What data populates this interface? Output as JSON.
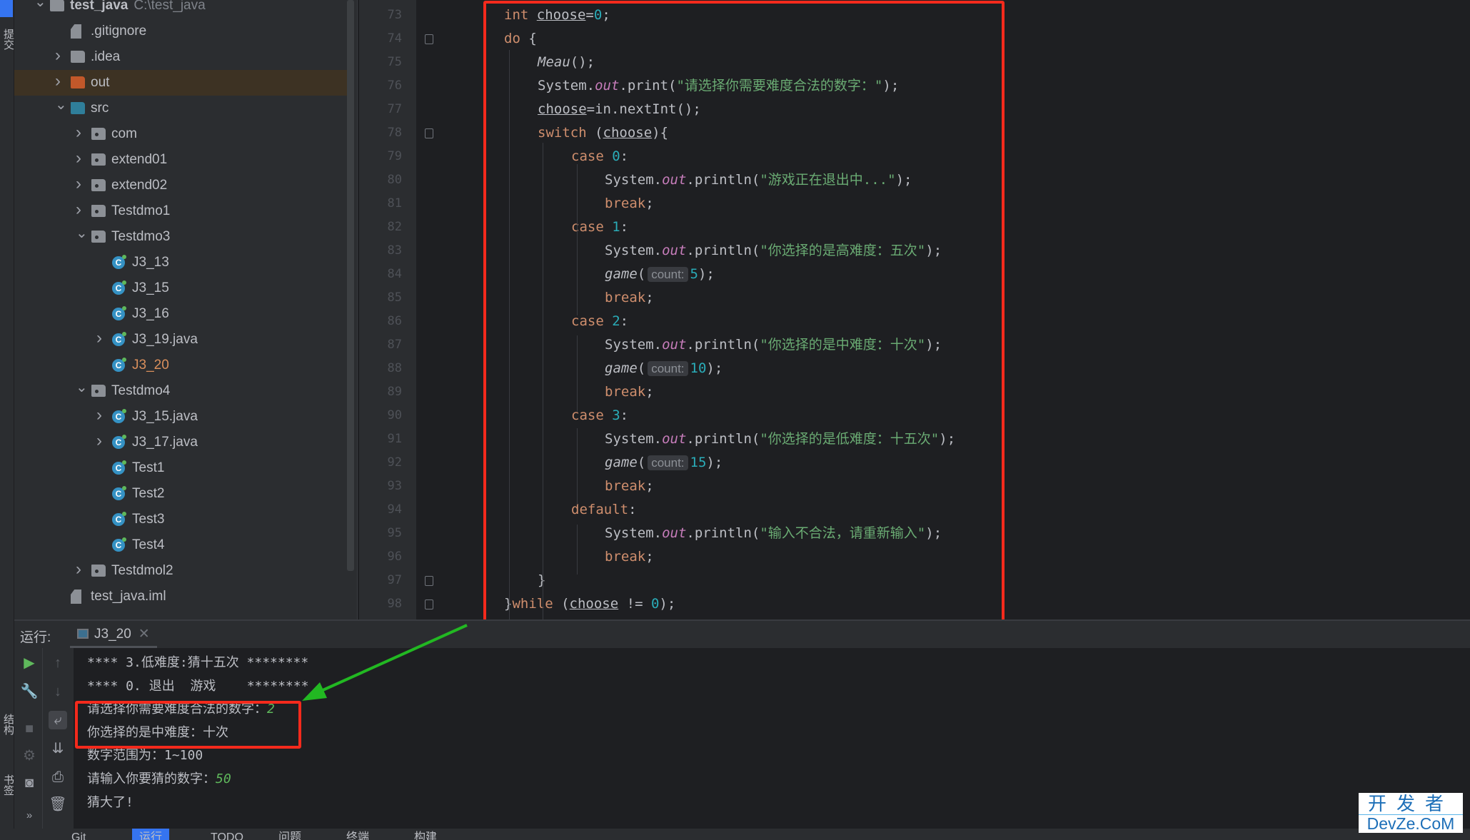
{
  "left_strip": {
    "labels": [
      "提交",
      "结构",
      "书签"
    ]
  },
  "project_tree": {
    "items": [
      {
        "level": 0,
        "chevron": "down",
        "icon": "project-icon",
        "label": "test_java",
        "path": "C:\\test_java"
      },
      {
        "level": 1,
        "chevron": "none",
        "icon": "ignore-file-icon",
        "label": ".gitignore"
      },
      {
        "level": 1,
        "chevron": "right",
        "icon": "folder-gray",
        "label": ".idea"
      },
      {
        "level": 1,
        "chevron": "right",
        "icon": "folder-orange",
        "label": "out",
        "highlighted": true
      },
      {
        "level": 1,
        "chevron": "down",
        "icon": "folder-blue",
        "label": "src"
      },
      {
        "level": 2,
        "chevron": "right",
        "icon": "package-icon",
        "label": "com"
      },
      {
        "level": 2,
        "chevron": "right",
        "icon": "package-icon",
        "label": "extend01"
      },
      {
        "level": 2,
        "chevron": "right",
        "icon": "package-icon",
        "label": "extend02"
      },
      {
        "level": 2,
        "chevron": "right",
        "icon": "package-icon",
        "label": "Testdmo1"
      },
      {
        "level": 2,
        "chevron": "down",
        "icon": "package-icon",
        "label": "Testdmo3"
      },
      {
        "level": 3,
        "chevron": "none",
        "icon": "class-icon",
        "label": "J3_13"
      },
      {
        "level": 3,
        "chevron": "none",
        "icon": "class-icon",
        "label": "J3_15"
      },
      {
        "level": 3,
        "chevron": "none",
        "icon": "class-icon",
        "label": "J3_16"
      },
      {
        "level": 3,
        "chevron": "right",
        "icon": "class-icon",
        "label": "J3_19.java"
      },
      {
        "level": 3,
        "chevron": "none",
        "icon": "class-icon",
        "label": "J3_20",
        "modified": true
      },
      {
        "level": 2,
        "chevron": "down",
        "icon": "package-icon",
        "label": "Testdmo4"
      },
      {
        "level": 3,
        "chevron": "right",
        "icon": "class-icon",
        "label": "J3_15.java"
      },
      {
        "level": 3,
        "chevron": "right",
        "icon": "class-icon",
        "label": "J3_17.java"
      },
      {
        "level": 3,
        "chevron": "none",
        "icon": "class-icon",
        "label": "Test1"
      },
      {
        "level": 3,
        "chevron": "none",
        "icon": "class-icon",
        "label": "Test2"
      },
      {
        "level": 3,
        "chevron": "none",
        "icon": "class-icon",
        "label": "Test3"
      },
      {
        "level": 3,
        "chevron": "none",
        "icon": "class-icon",
        "label": "Test4"
      },
      {
        "level": 2,
        "chevron": "right",
        "icon": "package-icon",
        "label": "Testdmol2"
      },
      {
        "level": 1,
        "chevron": "none",
        "icon": "module-file-icon",
        "label": "test_java.iml"
      }
    ]
  },
  "editor": {
    "lines": [
      {
        "num": "73",
        "indent": 1,
        "tokens": [
          [
            "int",
            "k"
          ],
          [
            " ",
            "p"
          ],
          [
            "choose",
            "u"
          ],
          [
            "=",
            "p"
          ],
          [
            "0",
            "n"
          ],
          [
            ";",
            "p"
          ]
        ]
      },
      {
        "num": "74",
        "indent": 1,
        "fold": true,
        "tokens": [
          [
            "do",
            "k"
          ],
          [
            " {",
            "p"
          ]
        ]
      },
      {
        "num": "75",
        "indent": 2,
        "tokens": [
          [
            "Meau",
            "m"
          ],
          [
            "();",
            "p"
          ]
        ]
      },
      {
        "num": "76",
        "indent": 2,
        "tokens": [
          [
            "System.",
            "p"
          ],
          [
            "out",
            "o"
          ],
          [
            ".print(",
            "p"
          ],
          [
            "\"请选择你需要难度合法的数字：\"",
            "s"
          ],
          [
            ");",
            "p"
          ]
        ]
      },
      {
        "num": "77",
        "indent": 2,
        "tokens": [
          [
            "choose",
            "u"
          ],
          [
            "=in.nextInt();",
            "p"
          ]
        ]
      },
      {
        "num": "78",
        "indent": 2,
        "fold": true,
        "tokens": [
          [
            "switch",
            "k"
          ],
          [
            " (",
            "p"
          ],
          [
            "choose",
            "u"
          ],
          [
            "){",
            "p"
          ]
        ]
      },
      {
        "num": "79",
        "indent": 3,
        "tokens": [
          [
            "case",
            "k"
          ],
          [
            " ",
            "p"
          ],
          [
            "0",
            "n"
          ],
          [
            ":",
            "p"
          ]
        ]
      },
      {
        "num": "80",
        "indent": 4,
        "tokens": [
          [
            "System.",
            "p"
          ],
          [
            "out",
            "o"
          ],
          [
            ".println(",
            "p"
          ],
          [
            "\"游戏正在退出中...\"",
            "s"
          ],
          [
            ");",
            "p"
          ]
        ]
      },
      {
        "num": "81",
        "indent": 4,
        "tokens": [
          [
            "break",
            "k"
          ],
          [
            ";",
            "p"
          ]
        ]
      },
      {
        "num": "82",
        "indent": 3,
        "tokens": [
          [
            "case",
            "k"
          ],
          [
            " ",
            "p"
          ],
          [
            "1",
            "n"
          ],
          [
            ":",
            "p"
          ]
        ]
      },
      {
        "num": "83",
        "indent": 4,
        "tokens": [
          [
            "System.",
            "p"
          ],
          [
            "out",
            "o"
          ],
          [
            ".println(",
            "p"
          ],
          [
            "\"你选择的是高难度：五次\"",
            "s"
          ],
          [
            ");",
            "p"
          ]
        ]
      },
      {
        "num": "84",
        "indent": 4,
        "tokens": [
          [
            "game",
            "m"
          ],
          [
            "(",
            "p"
          ],
          [
            "count:",
            "h"
          ],
          [
            "5",
            "n"
          ],
          [
            ");",
            "p"
          ]
        ]
      },
      {
        "num": "85",
        "indent": 4,
        "tokens": [
          [
            "break",
            "k"
          ],
          [
            ";",
            "p"
          ]
        ]
      },
      {
        "num": "86",
        "indent": 3,
        "tokens": [
          [
            "case",
            "k"
          ],
          [
            " ",
            "p"
          ],
          [
            "2",
            "n"
          ],
          [
            ":",
            "p"
          ]
        ]
      },
      {
        "num": "87",
        "indent": 4,
        "tokens": [
          [
            "System.",
            "p"
          ],
          [
            "out",
            "o"
          ],
          [
            ".println(",
            "p"
          ],
          [
            "\"你选择的是中难度：十次\"",
            "s"
          ],
          [
            ");",
            "p"
          ]
        ]
      },
      {
        "num": "88",
        "indent": 4,
        "tokens": [
          [
            "game",
            "m"
          ],
          [
            "(",
            "p"
          ],
          [
            "count:",
            "h"
          ],
          [
            "10",
            "n"
          ],
          [
            ");",
            "p"
          ]
        ]
      },
      {
        "num": "89",
        "indent": 4,
        "tokens": [
          [
            "break",
            "k"
          ],
          [
            ";",
            "p"
          ]
        ]
      },
      {
        "num": "90",
        "indent": 3,
        "tokens": [
          [
            "case",
            "k"
          ],
          [
            " ",
            "p"
          ],
          [
            "3",
            "n"
          ],
          [
            ":",
            "p"
          ]
        ]
      },
      {
        "num": "91",
        "indent": 4,
        "tokens": [
          [
            "System.",
            "p"
          ],
          [
            "out",
            "o"
          ],
          [
            ".println(",
            "p"
          ],
          [
            "\"你选择的是低难度：十五次\"",
            "s"
          ],
          [
            ");",
            "p"
          ]
        ]
      },
      {
        "num": "92",
        "indent": 4,
        "tokens": [
          [
            "game",
            "m"
          ],
          [
            "(",
            "p"
          ],
          [
            "count:",
            "h"
          ],
          [
            "15",
            "n"
          ],
          [
            ");",
            "p"
          ]
        ]
      },
      {
        "num": "93",
        "indent": 4,
        "tokens": [
          [
            "break",
            "k"
          ],
          [
            ";",
            "p"
          ]
        ]
      },
      {
        "num": "94",
        "indent": 3,
        "tokens": [
          [
            "default",
            "k"
          ],
          [
            ":",
            "p"
          ]
        ]
      },
      {
        "num": "95",
        "indent": 4,
        "tokens": [
          [
            "System.",
            "p"
          ],
          [
            "out",
            "o"
          ],
          [
            ".println(",
            "p"
          ],
          [
            "\"输入不合法，请重新输入\"",
            "s"
          ],
          [
            ");",
            "p"
          ]
        ]
      },
      {
        "num": "96",
        "indent": 4,
        "tokens": [
          [
            "break",
            "k"
          ],
          [
            ";",
            "p"
          ]
        ]
      },
      {
        "num": "97",
        "indent": 2,
        "fold": true,
        "tokens": [
          [
            "}",
            "p"
          ]
        ]
      },
      {
        "num": "98",
        "indent": 1,
        "fold": true,
        "tokens": [
          [
            "}",
            "p"
          ],
          [
            "while",
            "k"
          ],
          [
            " (",
            "p"
          ],
          [
            "choose",
            "u"
          ],
          [
            " != ",
            "p"
          ],
          [
            "0",
            "n"
          ],
          [
            ");",
            "p"
          ]
        ]
      }
    ]
  },
  "run_panel": {
    "label": "运行:",
    "tab": "J3_20",
    "console": [
      {
        "text": "**** 3.低难度:猜十五次 ********"
      },
      {
        "text": "**** 0. 退出  游戏    ********"
      },
      {
        "text": "请选择你需要难度合法的数字：",
        "input": "2"
      },
      {
        "text": "你选择的是中难度：十次"
      },
      {
        "text": "数字范围为：1~100"
      },
      {
        "text": "请输入你要猜的数字：",
        "input": "50"
      },
      {
        "text": "猜大了!"
      }
    ]
  },
  "bottom_bar": {
    "items": [
      "Git",
      "运行",
      "TODO",
      "问题",
      "终端",
      "构建"
    ],
    "active": "运行"
  },
  "watermark": {
    "line1": "开发者",
    "line2": "DevZe.CoM"
  },
  "colors": {
    "annotation_box": "#f42a1c",
    "arrow": "#22b822",
    "keyword": "#cf8e6d",
    "string": "#6aab73",
    "number": "#2aacb8"
  }
}
